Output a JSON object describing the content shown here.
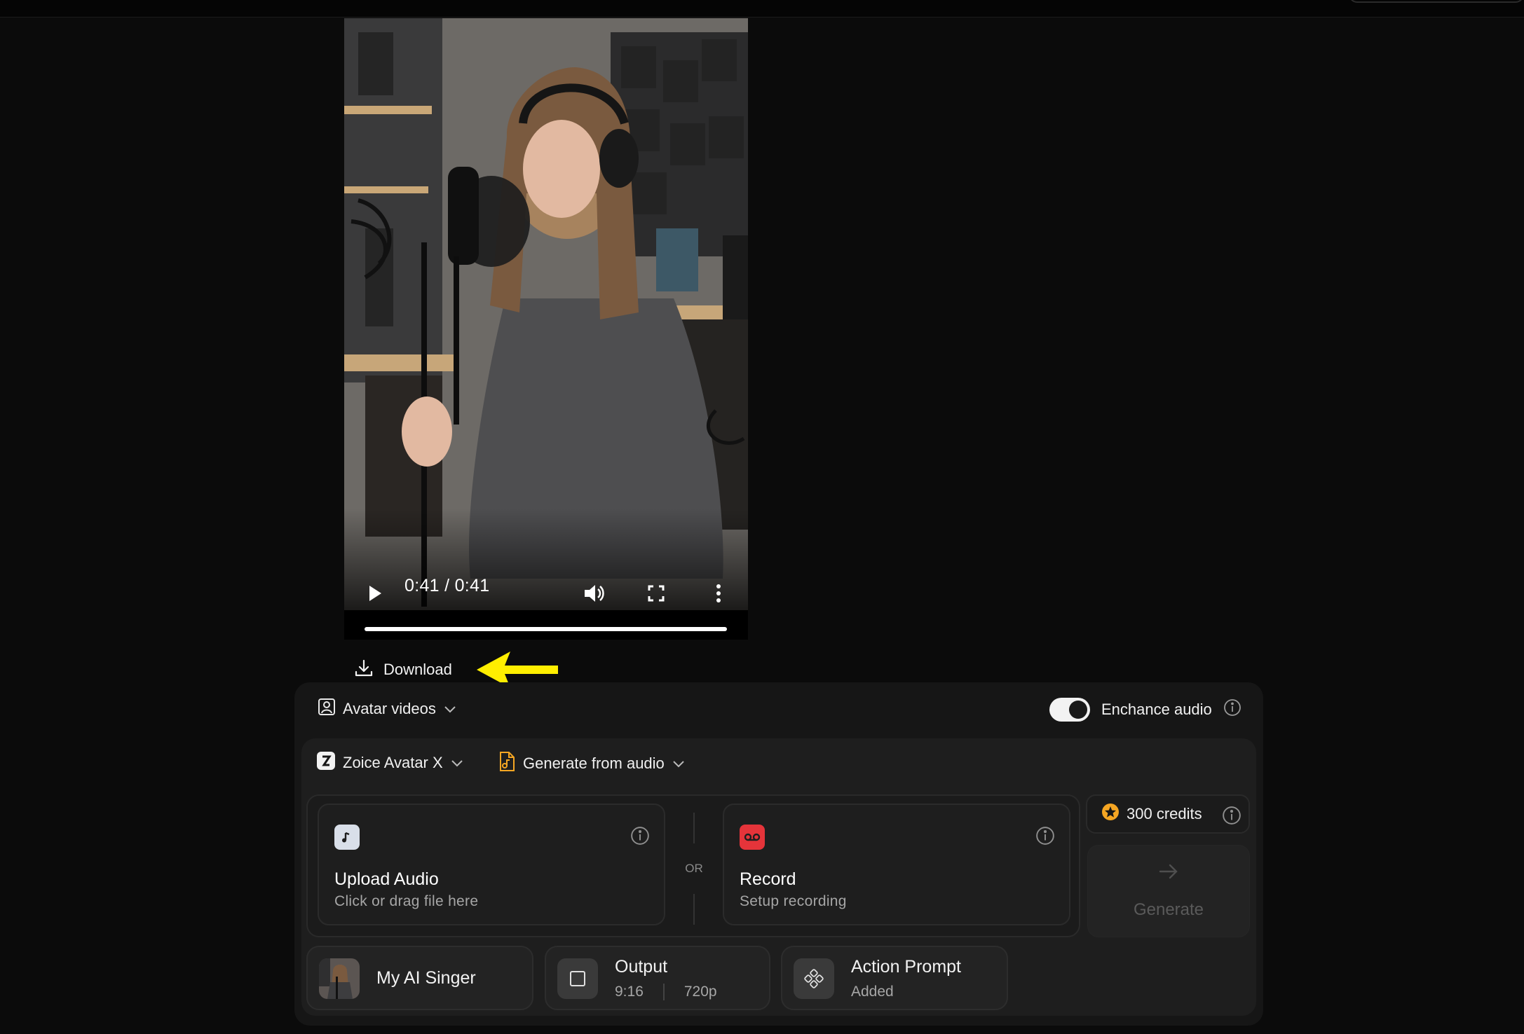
{
  "video": {
    "time": "0:41 / 0:41",
    "progress": 1.0
  },
  "download": {
    "label": "Download"
  },
  "mode": {
    "label": "Avatar videos"
  },
  "enhance": {
    "label": "Enchance audio",
    "enabled": true
  },
  "model": {
    "label": "Zoice Avatar X"
  },
  "generate_mode": {
    "label": "Generate from audio"
  },
  "upload": {
    "title": "Upload Audio",
    "subtitle": "Click or drag file here"
  },
  "separator": {
    "label": "OR"
  },
  "record": {
    "title": "Record",
    "subtitle": "Setup recording"
  },
  "credits": {
    "label": "300 credits"
  },
  "generate": {
    "label": "Generate"
  },
  "avatar_chip": {
    "label": "My AI Singer"
  },
  "output_chip": {
    "title": "Output",
    "ratio": "9:16",
    "resolution": "720p"
  },
  "action_chip": {
    "title": "Action Prompt",
    "status": "Added"
  },
  "colors": {
    "record_badge": "#e5343a",
    "upload_badge": "#d9dfe9",
    "credit_star": "#f5a623",
    "annotation_arrow": "#ffee00",
    "generate_icon": "#4a90e2"
  },
  "icons": {
    "play": "play-icon",
    "volume": "volume-icon",
    "fullscreen": "fullscreen-icon",
    "more": "more-vertical-icon",
    "download": "download-icon"
  }
}
